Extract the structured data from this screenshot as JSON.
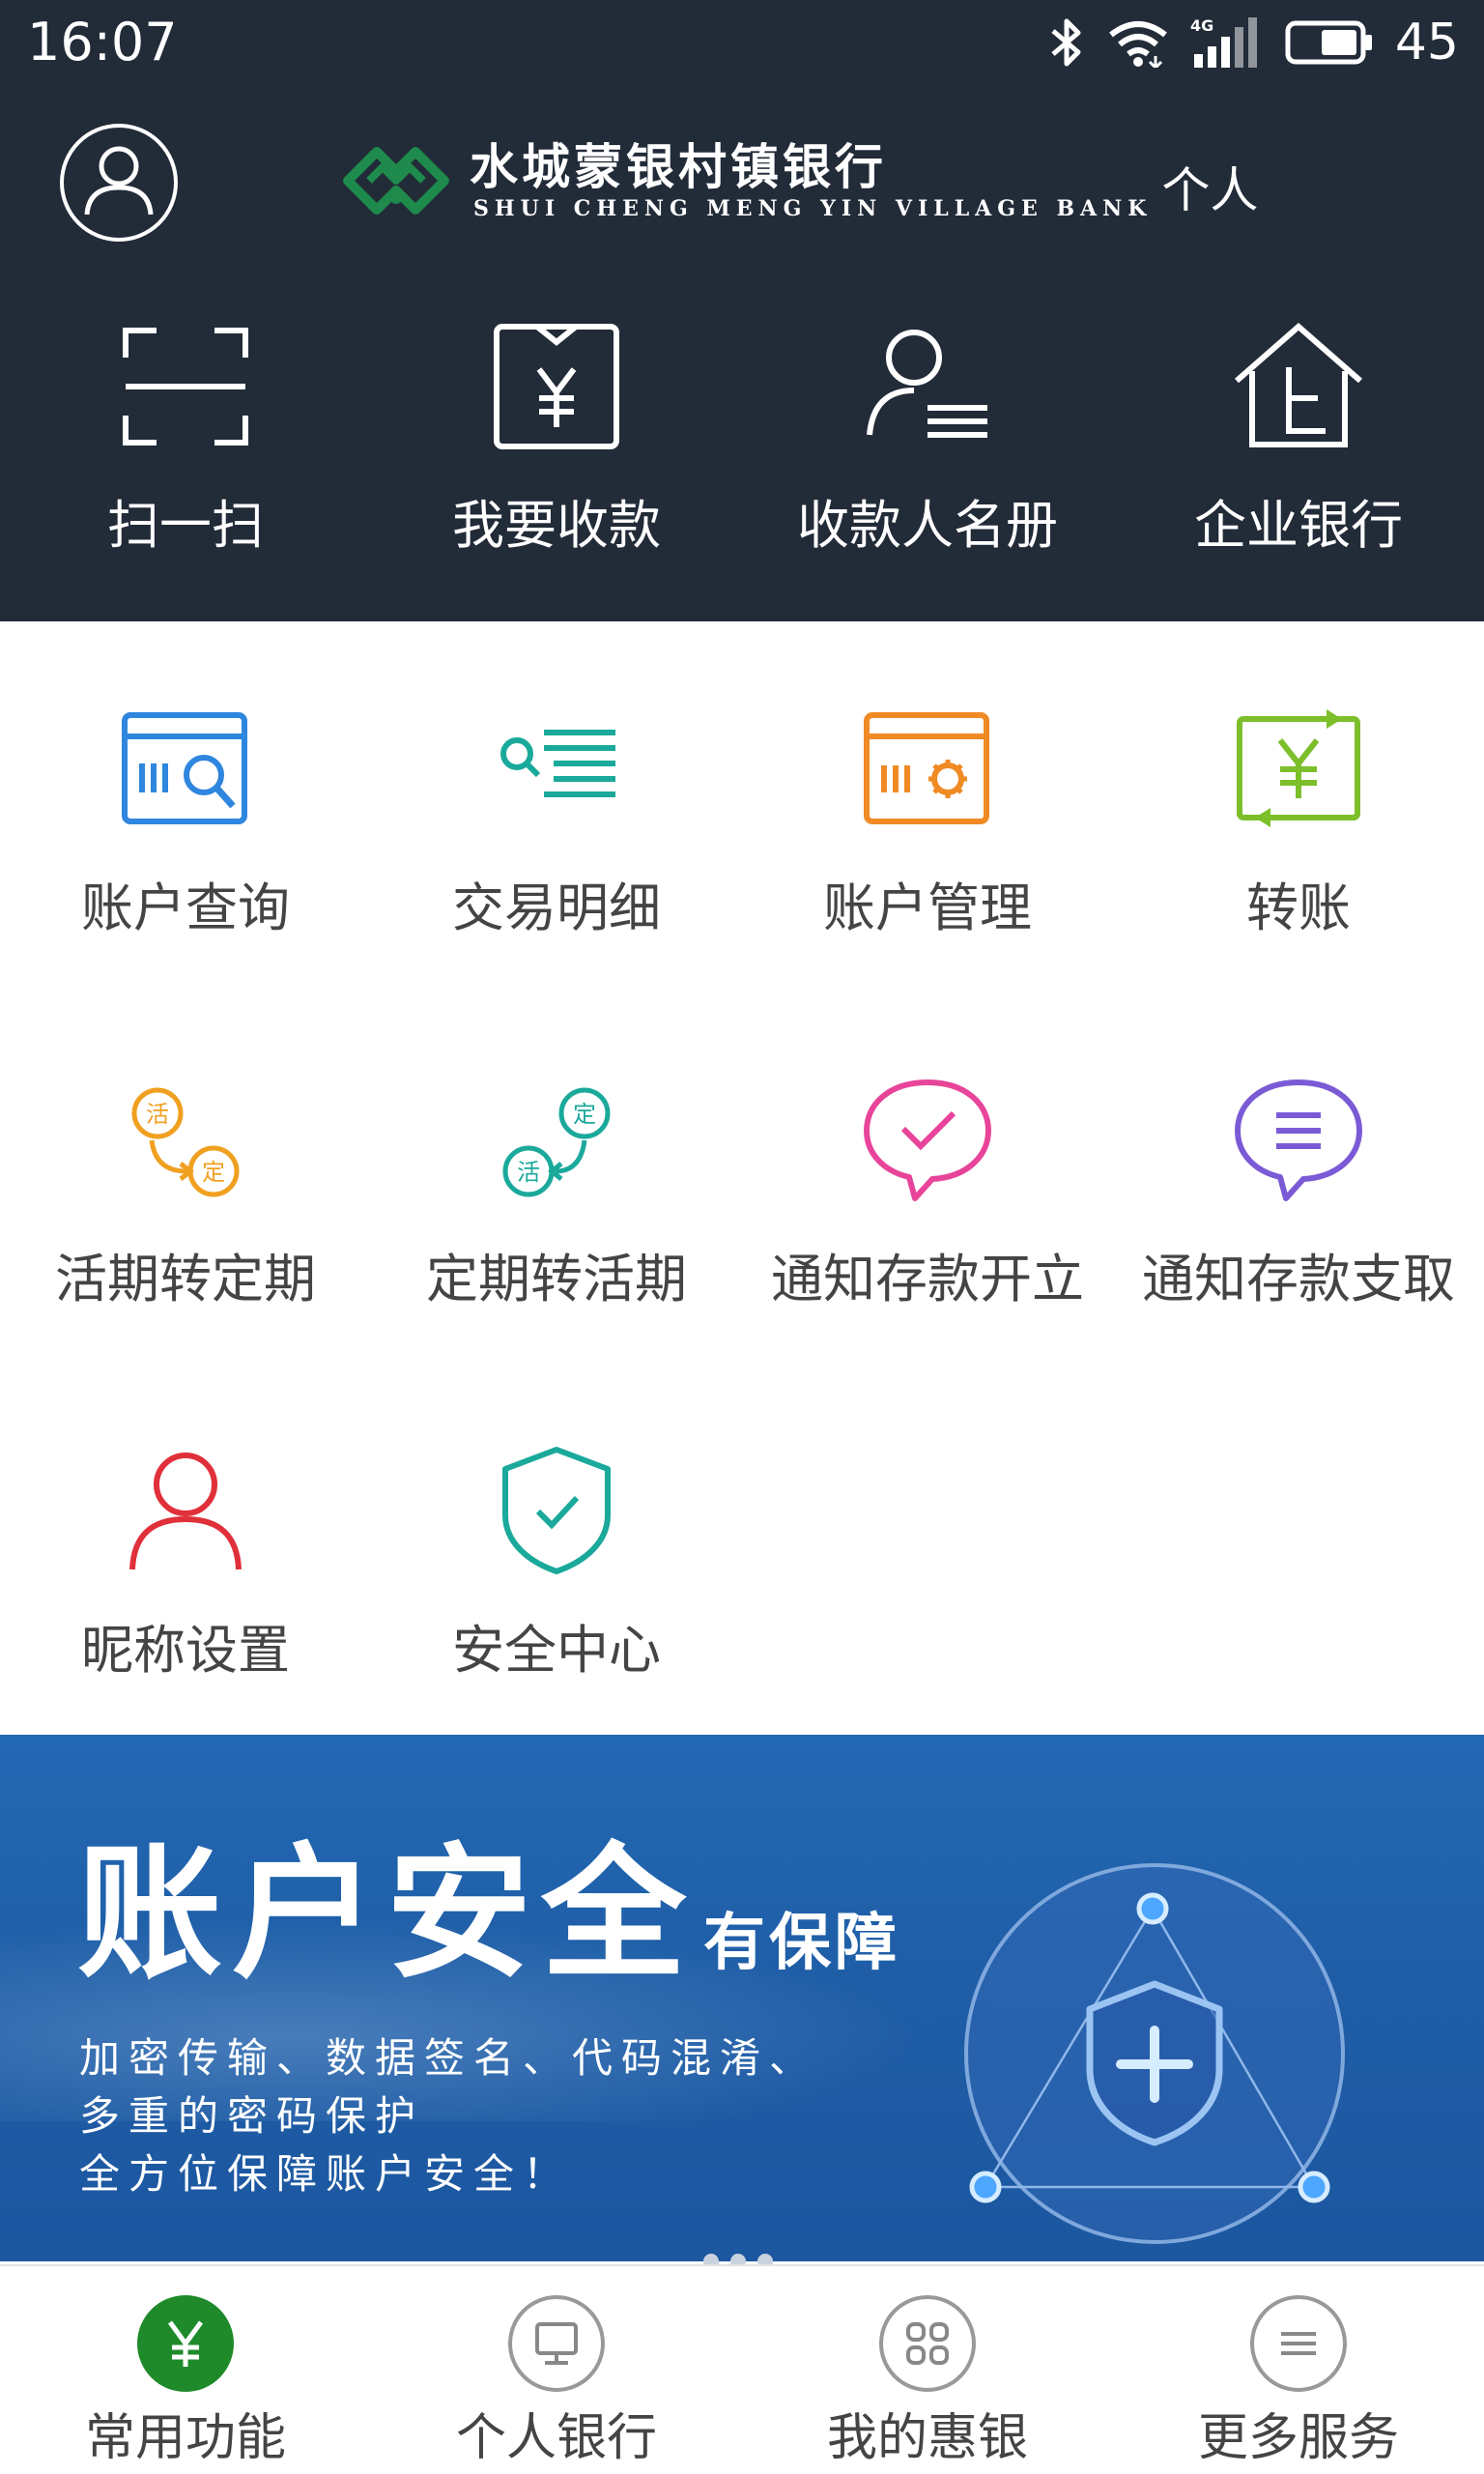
{
  "status_bar": {
    "time": "16:07",
    "battery": "45",
    "icons": [
      "bluetooth-icon",
      "wifi-icon",
      "signal-4g-icon",
      "battery-icon"
    ]
  },
  "header": {
    "brand_name_cn": "水城蒙银村镇银行",
    "brand_name_en": "SHUI CHENG MENG YIN VILLAGE BANK",
    "brand_type": "个人",
    "background_color": "#222b38",
    "logo_color": "#1e8a4c"
  },
  "quick_actions": [
    {
      "label": "扫一扫",
      "icon": "scan-icon"
    },
    {
      "label": "我要收款",
      "icon": "receive-money-icon"
    },
    {
      "label": "收款人名册",
      "icon": "payee-list-icon"
    },
    {
      "label": "企业银行",
      "icon": "enterprise-bank-icon"
    }
  ],
  "functions": [
    {
      "label": "账户查询",
      "icon": "account-query-icon",
      "color": "#2e86de"
    },
    {
      "label": "交易明细",
      "icon": "transaction-detail-icon",
      "color": "#1aa99b"
    },
    {
      "label": "账户管理",
      "icon": "account-manage-icon",
      "color": "#f08a24"
    },
    {
      "label": "转账",
      "icon": "transfer-icon",
      "color": "#7cbf2a"
    },
    {
      "label": "活期转定期",
      "icon": "current-to-fixed-icon",
      "color": "#f0a020"
    },
    {
      "label": "定期转活期",
      "icon": "fixed-to-current-icon",
      "color": "#1aa99b"
    },
    {
      "label": "通知存款开立",
      "icon": "notice-deposit-open-icon",
      "color": "#e8459a"
    },
    {
      "label": "通知存款支取",
      "icon": "notice-deposit-withdraw-icon",
      "color": "#7b5ad6"
    },
    {
      "label": "昵称设置",
      "icon": "nickname-icon",
      "color": "#e0303a"
    },
    {
      "label": "安全中心",
      "icon": "security-center-icon",
      "color": "#1aa99b"
    }
  ],
  "banner": {
    "title_big": "账户安全",
    "title_small": "有保障",
    "line1": "加密传输、数据签名、代码混淆、",
    "line2": "多重的密码保护",
    "line3": "全方位保障账户安全！",
    "graphic": "shield-plus-icon",
    "page_count": 3
  },
  "bottom_nav": [
    {
      "label": "常用功能",
      "icon": "yuan-icon",
      "active": true
    },
    {
      "label": "个人银行",
      "icon": "monitor-icon",
      "active": false
    },
    {
      "label": "我的惠银",
      "icon": "grid-apps-icon",
      "active": false
    },
    {
      "label": "更多服务",
      "icon": "menu-lines-icon",
      "active": false
    }
  ]
}
